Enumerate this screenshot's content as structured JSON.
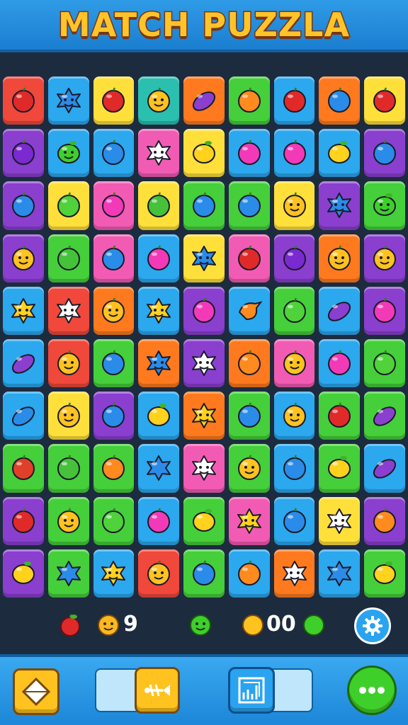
{
  "header": {
    "title": "MATCH PUZZLA"
  },
  "colors": {
    "red": "#f0483a",
    "blue": "#2ba8ee",
    "yellow": "#ffe03a",
    "teal": "#2bbfb0",
    "orange": "#ff7a1e",
    "green": "#45cf3a",
    "purple": "#8a3fcf",
    "pink": "#f25bb3",
    "lime": "#6fe23a"
  },
  "board": {
    "rows": [
      [
        [
          "red",
          "apple-icon"
        ],
        [
          "blue",
          "blob-face-icon"
        ],
        [
          "yellow",
          "apple-icon"
        ],
        [
          "teal",
          "smiley-icon"
        ],
        [
          "orange",
          "eggplant-icon"
        ],
        [
          "green",
          "orange-fruit-icon"
        ],
        [
          "blue",
          "apple-icon"
        ],
        [
          "orange",
          "plum-icon"
        ],
        [
          "yellow",
          "apple-icon"
        ]
      ],
      [
        [
          "purple",
          "bowling-ball-icon"
        ],
        [
          "blue",
          "pear-face-icon"
        ],
        [
          "blue",
          "blueberry-icon"
        ],
        [
          "pink",
          "cloud-face-icon"
        ],
        [
          "yellow",
          "lemon-icon"
        ],
        [
          "blue",
          "berry-icon"
        ],
        [
          "blue",
          "berry-icon"
        ],
        [
          "blue",
          "lemon-icon"
        ],
        [
          "purple",
          "plum-icon"
        ]
      ],
      [
        [
          "purple",
          "plum-icon"
        ],
        [
          "yellow",
          "lime-icon"
        ],
        [
          "pink",
          "berry-icon"
        ],
        [
          "yellow",
          "grape-icon"
        ],
        [
          "green",
          "blueberry-icon"
        ],
        [
          "green",
          "plum-icon"
        ],
        [
          "yellow",
          "smiley-icon"
        ],
        [
          "purple",
          "blob-face-icon"
        ],
        [
          "green",
          "pear-face-icon"
        ]
      ],
      [
        [
          "purple",
          "smiley-icon"
        ],
        [
          "green",
          "grape-icon"
        ],
        [
          "pink",
          "blueberry-icon"
        ],
        [
          "blue",
          "berry-icon"
        ],
        [
          "yellow",
          "blob-face-icon"
        ],
        [
          "pink",
          "apple-icon"
        ],
        [
          "purple",
          "bowling-ball-icon"
        ],
        [
          "orange",
          "smiley-icon"
        ],
        [
          "purple",
          "smiley-icon"
        ]
      ],
      [
        [
          "blue",
          "star-face-icon"
        ],
        [
          "red",
          "cloud-face-icon"
        ],
        [
          "orange",
          "smiley-icon"
        ],
        [
          "blue",
          "star-face-icon"
        ],
        [
          "purple",
          "berry-icon"
        ],
        [
          "blue",
          "bird-icon"
        ],
        [
          "green",
          "lime-icon"
        ],
        [
          "blue",
          "eggplant-icon"
        ],
        [
          "purple",
          "berry-icon"
        ]
      ],
      [
        [
          "blue",
          "eggplant-icon"
        ],
        [
          "red",
          "smiley-icon"
        ],
        [
          "green",
          "blueberry-icon"
        ],
        [
          "orange",
          "blob-face-icon"
        ],
        [
          "purple",
          "cloud-face-icon"
        ],
        [
          "orange",
          "orange-fruit-icon"
        ],
        [
          "pink",
          "smiley-icon"
        ],
        [
          "blue",
          "berry-icon"
        ],
        [
          "green",
          "lime-icon"
        ]
      ],
      [
        [
          "blue",
          "leaf-icon"
        ],
        [
          "yellow",
          "smiley-icon"
        ],
        [
          "purple",
          "blueberry-icon"
        ],
        [
          "blue",
          "lemon-icon"
        ],
        [
          "orange",
          "star-face-icon"
        ],
        [
          "green",
          "blueberry-icon"
        ],
        [
          "blue",
          "smiley-icon"
        ],
        [
          "green",
          "apple-icon"
        ],
        [
          "green",
          "eggplant-icon"
        ]
      ],
      [
        [
          "green",
          "strawberry-icon"
        ],
        [
          "green",
          "grape-icon"
        ],
        [
          "green",
          "orange-fruit-icon"
        ],
        [
          "blue",
          "blob-icon"
        ],
        [
          "pink",
          "cloud-face-icon"
        ],
        [
          "green",
          "smiley-icon"
        ],
        [
          "blue",
          "plum-icon"
        ],
        [
          "green",
          "lemon-icon"
        ],
        [
          "blue",
          "eggplant-icon"
        ]
      ],
      [
        [
          "purple",
          "apple-icon"
        ],
        [
          "green",
          "smiley-icon"
        ],
        [
          "green",
          "lime-icon"
        ],
        [
          "blue",
          "berry-icon"
        ],
        [
          "green",
          "lemon-icon"
        ],
        [
          "pink",
          "star-face-icon"
        ],
        [
          "blue",
          "plum-icon"
        ],
        [
          "yellow",
          "cloud-face-icon"
        ],
        [
          "purple",
          "orange-fruit-icon"
        ]
      ],
      [
        [
          "purple",
          "lemon-icon"
        ],
        [
          "green",
          "blob-icon"
        ],
        [
          "blue",
          "star-face-icon"
        ],
        [
          "red",
          "smiley-icon"
        ],
        [
          "green",
          "plum-icon"
        ],
        [
          "blue",
          "orange-fruit-icon"
        ],
        [
          "orange",
          "cloud-face-icon"
        ],
        [
          "blue",
          "blob-icon"
        ],
        [
          "green",
          "lemon-icon"
        ]
      ]
    ]
  },
  "stats": {
    "count_a": "9",
    "count_b": "00"
  },
  "toolbar": {
    "buttons": [
      "diamond-icon",
      "fish-bone-icon",
      "grid-icon",
      "more-icon"
    ]
  }
}
